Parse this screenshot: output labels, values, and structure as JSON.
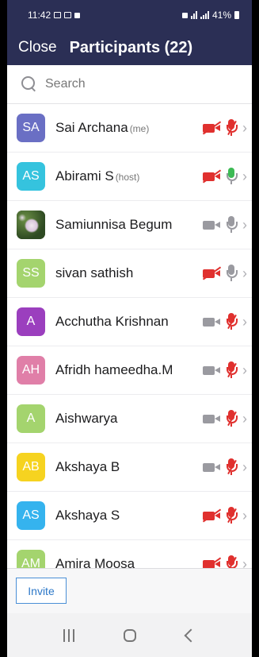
{
  "status_bar": {
    "time": "11:42",
    "battery": "41%"
  },
  "header": {
    "close_label": "Close",
    "title": "Participants (22)"
  },
  "search": {
    "placeholder": "Search"
  },
  "participants": [
    {
      "initials": "SA",
      "name": "Sai Archana",
      "tag": "(me)",
      "avatar_color": "#6a6fc4",
      "video": "off",
      "mic": "muted"
    },
    {
      "initials": "AS",
      "name": "Abirami S",
      "tag": "(host)",
      "avatar_color": "#35c3de",
      "video": "off",
      "mic": "talking"
    },
    {
      "initials": "",
      "name": "Samiunnisa Begum",
      "tag": "",
      "avatar_color": "photo",
      "video": "on",
      "mic": "unmuted"
    },
    {
      "initials": "SS",
      "name": "sivan sathish",
      "tag": "",
      "avatar_color": "#a4d46e",
      "video": "off",
      "mic": "unmuted"
    },
    {
      "initials": "A",
      "name": "Acchutha Krishnan",
      "tag": "",
      "avatar_color": "#9b3fbe",
      "video": "on",
      "mic": "muted"
    },
    {
      "initials": "AH",
      "name": "Afridh hameedha.M",
      "tag": "",
      "avatar_color": "#e07fa8",
      "video": "on",
      "mic": "muted"
    },
    {
      "initials": "A",
      "name": "Aishwarya",
      "tag": "",
      "avatar_color": "#a4d46e",
      "video": "on",
      "mic": "muted"
    },
    {
      "initials": "AB",
      "name": "Akshaya B",
      "tag": "",
      "avatar_color": "#f6d320",
      "video": "on",
      "mic": "muted"
    },
    {
      "initials": "AS",
      "name": "Akshaya S",
      "tag": "",
      "avatar_color": "#35b3ee",
      "video": "off",
      "mic": "muted"
    },
    {
      "initials": "AM",
      "name": "Amira Moosa",
      "tag": "",
      "avatar_color": "#a4d46e",
      "video": "off",
      "mic": "muted"
    }
  ],
  "footer": {
    "invite_label": "Invite"
  },
  "colors": {
    "header_bg": "#2b2f55",
    "muted_red": "#e0302e",
    "talking_green": "#3cba54",
    "invite_blue": "#2d78c8"
  }
}
